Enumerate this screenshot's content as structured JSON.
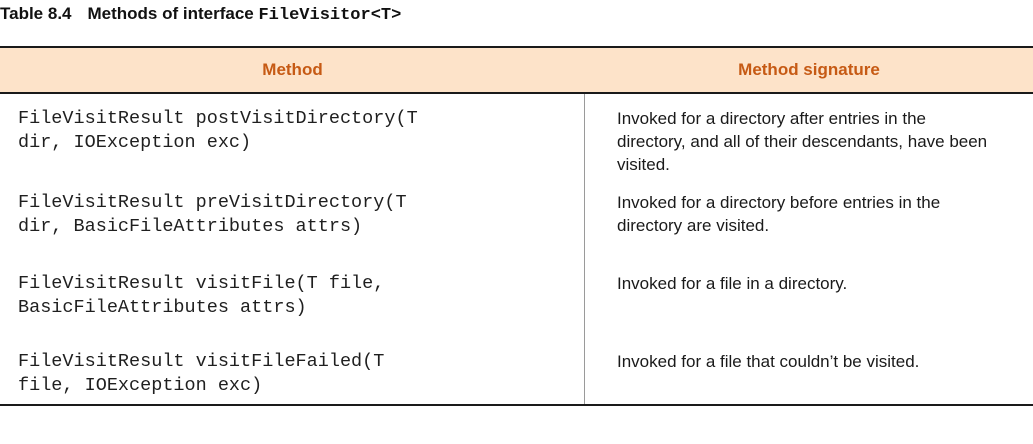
{
  "caption": {
    "label": "Table 8.4",
    "text": "Methods of interface",
    "code": "FileVisitor<T>"
  },
  "table": {
    "headers": [
      "Method",
      "Method signature"
    ],
    "rows": [
      {
        "method_line1": "FileVisitResult postVisitDirectory(T",
        "method_line2": "dir, IOException exc)",
        "description": "Invoked for a directory after entries in the directory, and all of their descendants, have been visited."
      },
      {
        "method_line1": "FileVisitResult preVisitDirectory(T",
        "method_line2": "dir, BasicFileAttributes attrs)",
        "description": "Invoked for a directory before entries in the directory are visited."
      },
      {
        "method_line1": "FileVisitResult visitFile(T file,",
        "method_line2": "BasicFileAttributes attrs)",
        "description": "Invoked for a file in a directory."
      },
      {
        "method_line1": "FileVisitResult visitFileFailed(T",
        "method_line2": "file, IOException exc)",
        "description": "Invoked for a file that couldn’t be visited."
      }
    ]
  }
}
